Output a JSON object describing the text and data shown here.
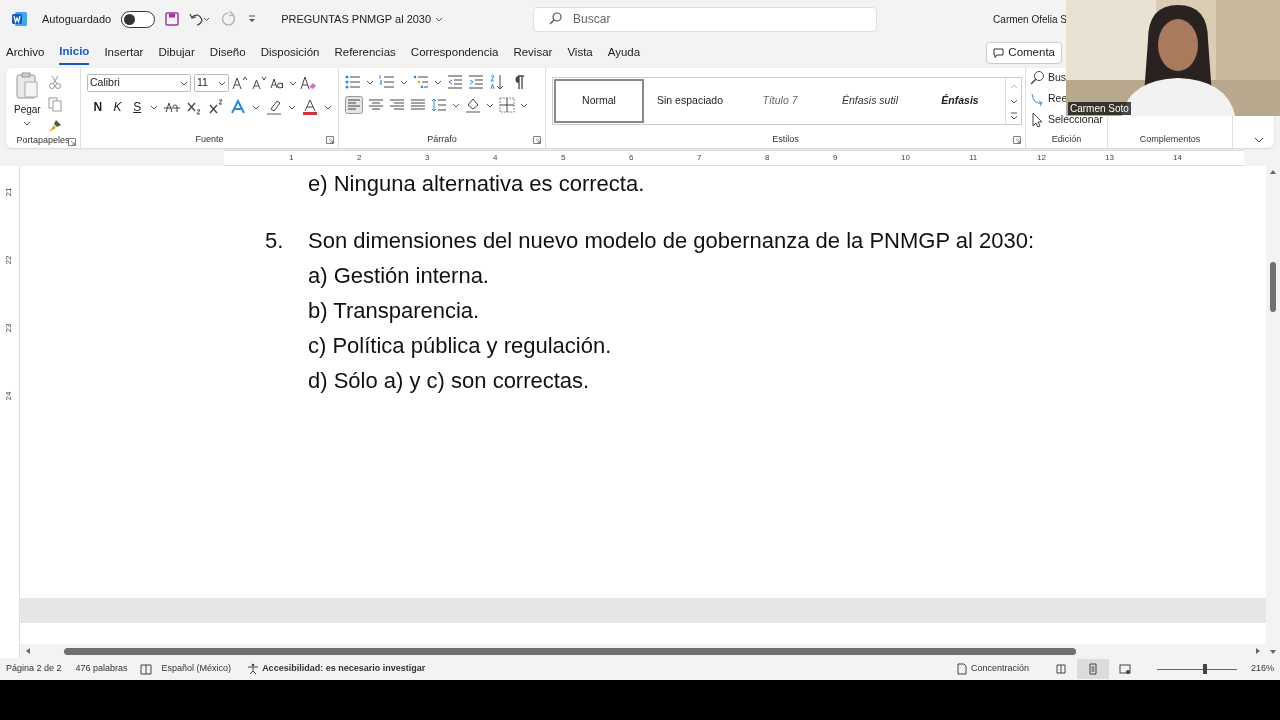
{
  "title_bar": {
    "autosave_label": "Autoguardado",
    "autosave_on": false,
    "document_title": "PREGUNTAS PNMGP al 2030",
    "search_placeholder": "Buscar",
    "user_name": "Carmen Ofelia S"
  },
  "menu_tabs": [
    {
      "label": "Archivo",
      "selected": false
    },
    {
      "label": "Inicio",
      "selected": true
    },
    {
      "label": "Insertar",
      "selected": false
    },
    {
      "label": "Dibujar",
      "selected": false
    },
    {
      "label": "Diseño",
      "selected": false
    },
    {
      "label": "Disposición",
      "selected": false
    },
    {
      "label": "Referencias",
      "selected": false
    },
    {
      "label": "Correspondencia",
      "selected": false
    },
    {
      "label": "Revisar",
      "selected": false
    },
    {
      "label": "Vista",
      "selected": false
    },
    {
      "label": "Ayuda",
      "selected": false
    }
  ],
  "comment_button": "Comenta",
  "ribbon": {
    "clipboard": {
      "paste_label": "Pegar",
      "group_label": "Portapapeles"
    },
    "font": {
      "font_name": "Calibri",
      "font_size": "11",
      "format_buttons": [
        "N",
        "K",
        "S"
      ],
      "group_label": "Fuente"
    },
    "paragraph": {
      "group_label": "Párrafo"
    },
    "styles": {
      "items": [
        {
          "label": "Normal",
          "selected": true,
          "kind": "plain"
        },
        {
          "label": "Sin espaciado",
          "selected": false,
          "kind": "plain"
        },
        {
          "label": "Título 7",
          "selected": false,
          "kind": "light-italic"
        },
        {
          "label": "Énfasis sutil",
          "selected": false,
          "kind": "italic"
        },
        {
          "label": "Énfasis",
          "selected": false,
          "kind": "bold-italic"
        }
      ],
      "group_label": "Estilos"
    },
    "editing": {
      "items": [
        "Bus",
        "Ree",
        "Seleccionar"
      ],
      "group_label": "Edición"
    },
    "addins": {
      "group_label": "Complementos"
    }
  },
  "ruler": {
    "numbers": [
      "1",
      "2",
      "3",
      "4",
      "5",
      "6",
      "7",
      "8",
      "9",
      "10",
      "11",
      "12",
      "13",
      "14"
    ],
    "vertical_numbers": [
      "21",
      "22",
      "23",
      "24"
    ]
  },
  "document": {
    "previous_option": "e) Ninguna alternativa es correcta.",
    "question": {
      "number": "5.",
      "text": "Son dimensiones del nuevo modelo de gobernanza de la PNMGP al 2030:"
    },
    "options": [
      "a) Gestión interna.",
      "b) Transparencia.",
      "c) Política pública y regulación.",
      "d) Sólo a) y c) son correctas."
    ]
  },
  "status_bar": {
    "page": "Página 2 de 2",
    "words": "476 palabras",
    "language": "Español (México)",
    "accessibility": "Accesibilidad: es necesario investigar",
    "focus": "Concentración",
    "views": [
      {
        "kind": "read",
        "selected": false
      },
      {
        "kind": "print",
        "selected": true
      },
      {
        "kind": "web",
        "selected": false
      }
    ],
    "zoom": {
      "level": 0.6,
      "reading": "216%"
    }
  },
  "video": {
    "kind": "picture",
    "name_label": "Carmen Soto"
  }
}
